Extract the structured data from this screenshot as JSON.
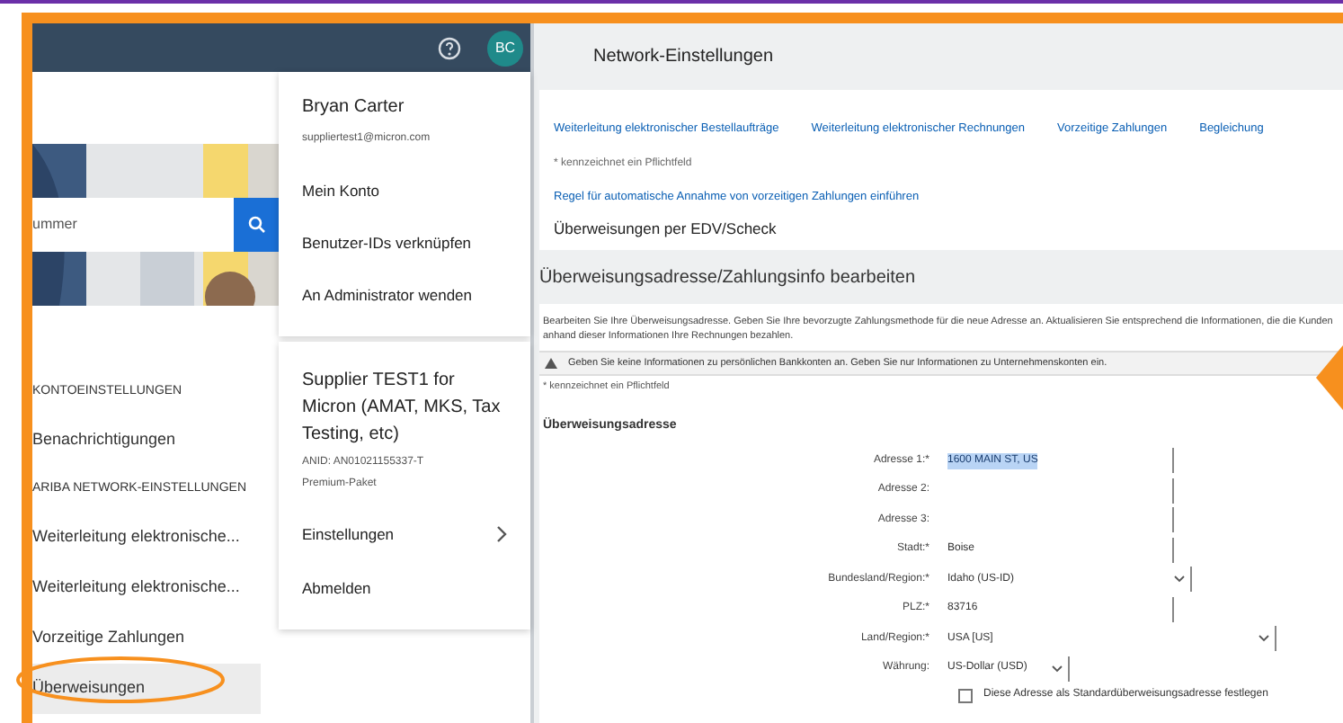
{
  "top_bar": {
    "avatar_initials": "BC"
  },
  "search": {
    "placeholder": "ummer"
  },
  "sidebar": {
    "sections": [
      {
        "heading": "KONTOEINSTELLUNGEN",
        "items": [
          {
            "label": "Benachrichtigungen",
            "selected": false
          }
        ]
      },
      {
        "heading": "ARIBA NETWORK-EINSTELLUNGEN",
        "items": [
          {
            "label": "Weiterleitung elektronische...",
            "selected": false
          },
          {
            "label": "Weiterleitung elektronische...",
            "selected": false
          },
          {
            "label": "Vorzeitige Zahlungen",
            "selected": false
          },
          {
            "label": "Überweisungen",
            "selected": true
          }
        ]
      }
    ]
  },
  "user_menu": {
    "name": "Bryan Carter",
    "email": "suppliertest1@micron.com",
    "items": [
      "Mein Konto",
      "Benutzer-IDs verknüpfen",
      "An Administrator wenden"
    ],
    "account": {
      "company": "Supplier TEST1 for Micron (AMAT, MKS, Tax Testing, etc)",
      "anid": "ANID: AN01021155337-T",
      "package": "Premium-Paket"
    },
    "account_items": [
      {
        "label": "Einstellungen",
        "submenu": true
      },
      {
        "label": "Abmelden",
        "submenu": false
      }
    ]
  },
  "page": {
    "title": "Network-Einstellungen",
    "links": [
      "Weiterleitung elektronischer Bestellaufträge",
      "Weiterleitung elektronischer Rechnungen",
      "Vorzeitige Zahlungen",
      "Begleichung"
    ],
    "required_note": "* kennzeichnet ein Pflichtfeld",
    "rule_link": "Regel für automatische Annahme von vorzeitigen Zahlungen einführen",
    "section_title": "Überweisungen per EDV/Scheck"
  },
  "edit": {
    "title": "Überweisungsadresse/Zahlungsinfo bearbeiten",
    "description": "Bearbeiten Sie Ihre Überweisungsadresse. Geben Sie Ihre bevorzugte Zahlungsmethode für die neue Adresse an. Aktualisieren Sie entsprechend die Informationen, die die Kunden anhand dieser Informationen Ihre Rechnungen bezahlen.",
    "warning": "Geben Sie keine Informationen zu persönlichen Bankkonten an. Geben Sie nur Informationen zu Unternehmenskonten ein.",
    "required_note": "* kennzeichnet ein Pflichtfeld",
    "form_title": "Überweisungsadresse",
    "fields": [
      {
        "label": "Adresse 1:*",
        "value": "1600 MAIN ST, US",
        "kind": "text",
        "highlighted": true
      },
      {
        "label": "Adresse 2:",
        "kind": "text"
      },
      {
        "label": "Adresse 3:",
        "kind": "text"
      },
      {
        "label": "Stadt:*",
        "value": "Boise",
        "kind": "text",
        "highlighted": false
      },
      {
        "label": "Bundesland/Region:*",
        "value": "Idaho (US-ID)",
        "kind": "select",
        "highlighted": false
      },
      {
        "label": "PLZ:*",
        "value": "83716",
        "kind": "text",
        "highlighted": false
      },
      {
        "label": "Land/Region:*",
        "value": "USA [US]",
        "kind": "select",
        "highlighted": false
      },
      {
        "label": "Währung:",
        "value": "US-Dollar (USD)",
        "kind": "select",
        "highlighted": false
      }
    ],
    "checkbox": {
      "label": "Diese Adresse als Standardüberweisungsadresse festlegen",
      "checked": false
    }
  }
}
